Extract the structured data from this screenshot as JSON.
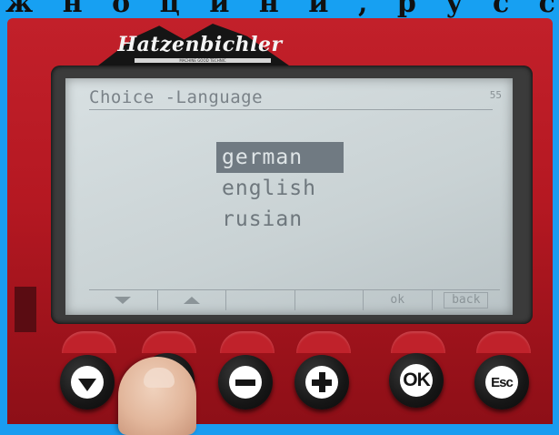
{
  "caption": {
    "text": "ж н о ц и н и , р у с с к и й )"
  },
  "device": {
    "brand": "Hatzenbichler",
    "brand_tagline": "MACHINE GOOD TECHNIC"
  },
  "screen": {
    "title": "Choice -Language",
    "corner_indicator": "55",
    "menu_items": [
      {
        "label": "german",
        "selected": true
      },
      {
        "label": "english",
        "selected": false
      },
      {
        "label": "rusian",
        "selected": false
      }
    ],
    "softkeys": [
      {
        "icon": "down-triangle-icon",
        "label": ""
      },
      {
        "icon": "up-triangle-icon",
        "label": ""
      },
      {
        "icon": "",
        "label": ""
      },
      {
        "icon": "",
        "label": ""
      },
      {
        "icon": "",
        "label": "ok"
      },
      {
        "icon": "",
        "label": "back"
      }
    ]
  },
  "buttons": {
    "down": {
      "icon": "down-arrow-icon",
      "label": ""
    },
    "second": {
      "icon": "blank",
      "label": ""
    },
    "minus": {
      "icon": "minus-icon",
      "label": ""
    },
    "plus": {
      "icon": "plus-icon",
      "label": ""
    },
    "ok": {
      "icon": "",
      "label": "OK"
    },
    "esc": {
      "icon": "",
      "label": "Esc"
    }
  },
  "colors": {
    "housing": "#b51822",
    "screen_bg": "#cfd7d9",
    "selection": "#707a82",
    "backdrop": "#1a9cf0"
  }
}
